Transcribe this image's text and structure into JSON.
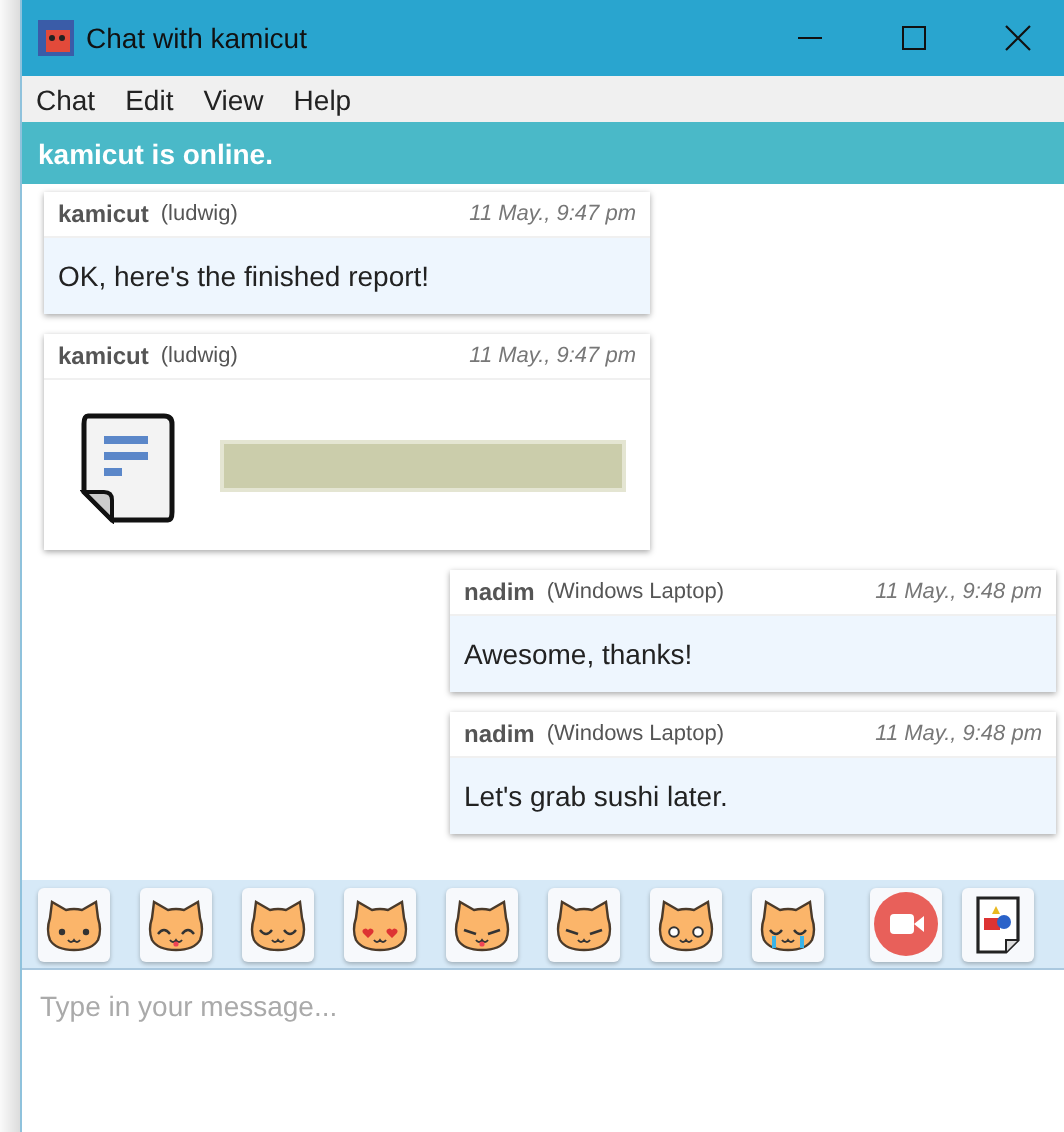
{
  "window": {
    "title": "Chat with kamicut"
  },
  "menu": [
    "Chat",
    "Edit",
    "View",
    "Help"
  ],
  "status": "kamicut is online.",
  "messages": [
    {
      "kind": "text",
      "own": false,
      "sender": "kamicut",
      "device": "(ludwig)",
      "time": "11 May., 9:47 pm",
      "text": "OK, here's the finished report!"
    },
    {
      "kind": "file",
      "own": false,
      "sender": "kamicut",
      "device": "(ludwig)",
      "time": "11 May., 9:47 pm"
    },
    {
      "kind": "text",
      "own": true,
      "sender": "nadim",
      "device": "(Windows Laptop)",
      "time": "11 May., 9:48 pm",
      "text": "Awesome, thanks!"
    },
    {
      "kind": "text",
      "own": true,
      "sender": "nadim",
      "device": "(Windows Laptop)",
      "time": "11 May., 9:48 pm",
      "text": "Let's grab sushi later."
    }
  ],
  "toolbar": [
    {
      "kind": "smile"
    },
    {
      "kind": "tongue"
    },
    {
      "kind": "content"
    },
    {
      "kind": "kiss"
    },
    {
      "kind": "smirk"
    },
    {
      "kind": "annoyed"
    },
    {
      "kind": "surprised"
    },
    {
      "kind": "crying"
    },
    {
      "kind": "video"
    },
    {
      "kind": "send-file"
    }
  ],
  "composer": {
    "placeholder": "Type in your message..."
  }
}
